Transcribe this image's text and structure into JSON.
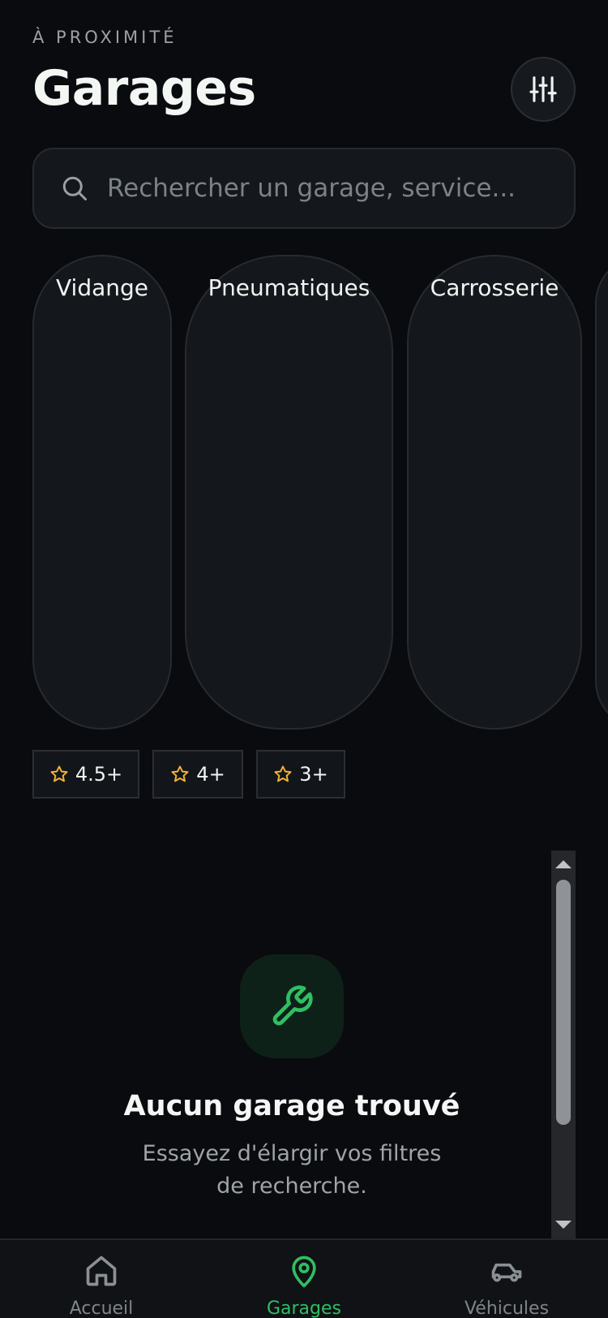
{
  "header": {
    "eyebrow": "À PROXIMITÉ",
    "title": "Garages",
    "filter_icon": "sliders-icon"
  },
  "search": {
    "placeholder": "Rechercher un garage, service...",
    "value": "",
    "icon": "search-icon"
  },
  "categories": [
    {
      "label": "Vidange"
    },
    {
      "label": "Pneumatiques"
    },
    {
      "label": "Carrosserie"
    },
    {
      "label": ""
    }
  ],
  "ratings": [
    {
      "label": "4.5+",
      "icon": "star-icon"
    },
    {
      "label": "4+",
      "icon": "star-icon"
    },
    {
      "label": "3+",
      "icon": "star-icon"
    }
  ],
  "empty_state": {
    "icon": "wrench-icon",
    "title": "Aucun garage trouvé",
    "subtitle": "Essayez d'élargir vos filtres de recherche."
  },
  "bottom_nav": [
    {
      "label": "Accueil",
      "icon": "home-icon",
      "active": false
    },
    {
      "label": "Garages",
      "icon": "map-pin-icon",
      "active": true
    },
    {
      "label": "Véhicules",
      "icon": "car-icon",
      "active": false
    }
  ],
  "colors": {
    "background": "#0a0b0e",
    "accent": "#2fbf62",
    "star": "#f2b233",
    "surface": "#14171b"
  }
}
